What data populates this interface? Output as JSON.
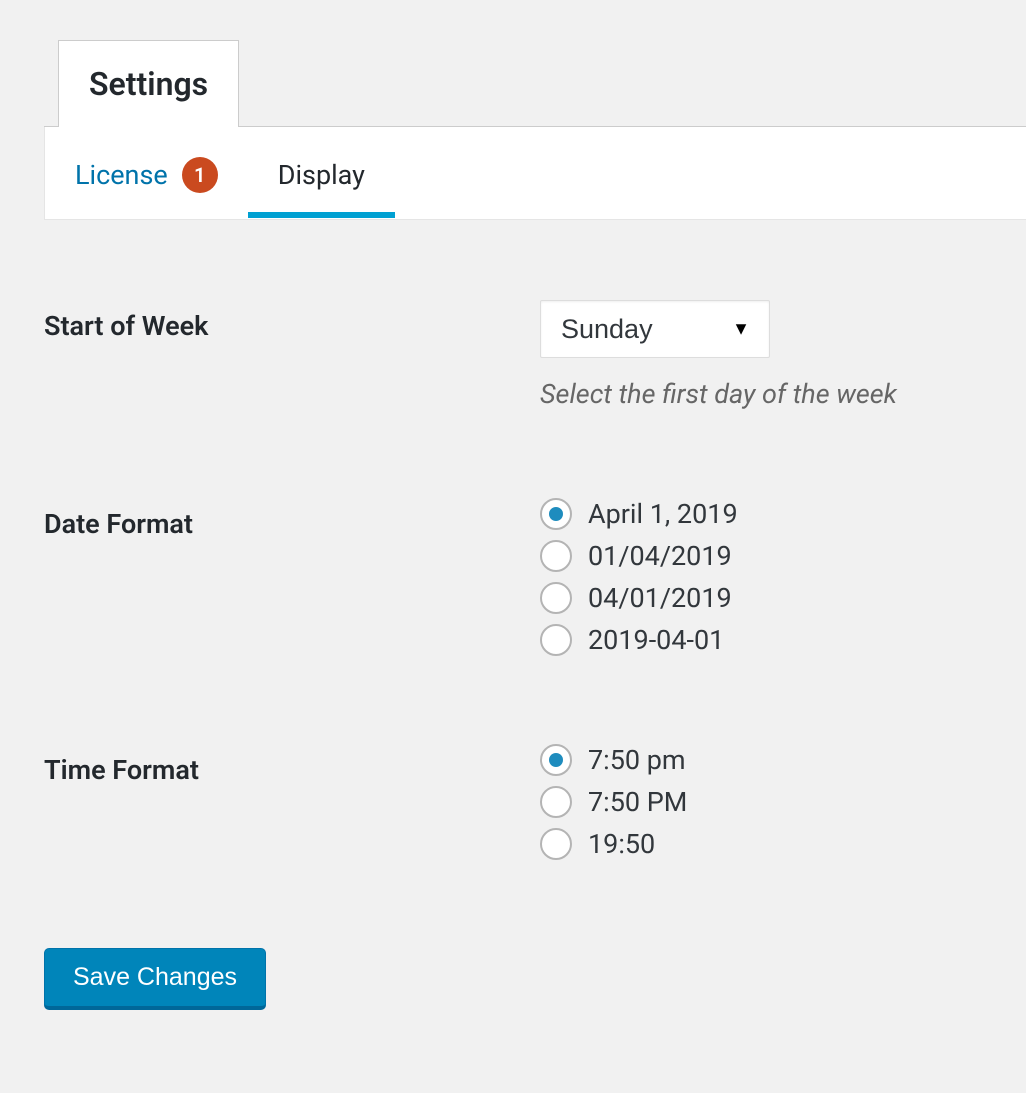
{
  "mainTab": {
    "label": "Settings"
  },
  "subTabs": {
    "license": {
      "label": "License",
      "badge": "1"
    },
    "display": {
      "label": "Display"
    }
  },
  "startOfWeek": {
    "label": "Start of Week",
    "selected": "Sunday",
    "help": "Select the first day of the week"
  },
  "dateFormat": {
    "label": "Date Format",
    "options": [
      {
        "label": "April 1, 2019",
        "checked": true
      },
      {
        "label": "01/04/2019",
        "checked": false
      },
      {
        "label": "04/01/2019",
        "checked": false
      },
      {
        "label": "2019-04-01",
        "checked": false
      }
    ]
  },
  "timeFormat": {
    "label": "Time Format",
    "options": [
      {
        "label": "7:50 pm",
        "checked": true
      },
      {
        "label": "7:50 PM",
        "checked": false
      },
      {
        "label": "19:50",
        "checked": false
      }
    ]
  },
  "saveButton": {
    "label": "Save Changes"
  }
}
